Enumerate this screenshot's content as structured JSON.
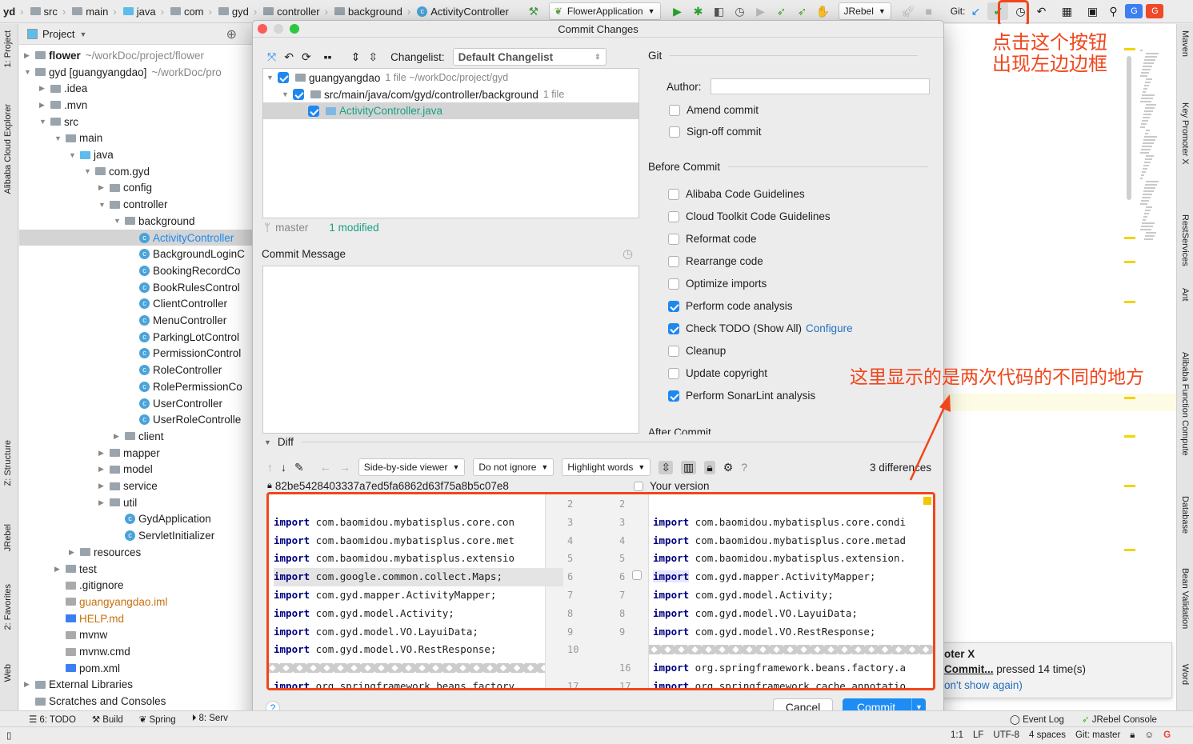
{
  "navbar": {
    "breadcrumbs": [
      "yd",
      "src",
      "main",
      "java",
      "com",
      "gyd",
      "controller",
      "background",
      "ActivityController"
    ],
    "run_config": "FlowerApplication",
    "jrebel": "JRebel",
    "git_label": "Git:"
  },
  "left_strip": [
    "1: Project",
    "Alibaba Cloud Explorer",
    "Z: Structure",
    "JRebel",
    "2: Favorites",
    "Web"
  ],
  "right_strip": [
    "Maven",
    "Key Promoter X",
    "RestServices",
    "Ant",
    "Alibaba Function Compute",
    "Database",
    "Bean Validation",
    "Word"
  ],
  "project": {
    "title": "Project",
    "tree": [
      {
        "label": "flower",
        "hint": "~/workDoc/project/flower",
        "level": 0,
        "arrow": "right",
        "icon": "module",
        "bold": true
      },
      {
        "label": "gyd [guangyangdao]",
        "hint": "~/workDoc/pro",
        "level": 0,
        "arrow": "down",
        "icon": "module",
        "bold": false
      },
      {
        "label": ".idea",
        "level": 1,
        "arrow": "right",
        "icon": "folder"
      },
      {
        "label": ".mvn",
        "level": 1,
        "arrow": "right",
        "icon": "folder"
      },
      {
        "label": "src",
        "level": 1,
        "arrow": "down",
        "icon": "folder"
      },
      {
        "label": "main",
        "level": 2,
        "arrow": "down",
        "icon": "folder"
      },
      {
        "label": "java",
        "level": 3,
        "arrow": "down",
        "icon": "folder-blue"
      },
      {
        "label": "com.gyd",
        "level": 4,
        "arrow": "down",
        "icon": "package"
      },
      {
        "label": "config",
        "level": 5,
        "arrow": "right",
        "icon": "package"
      },
      {
        "label": "controller",
        "level": 5,
        "arrow": "down",
        "icon": "package"
      },
      {
        "label": "background",
        "level": 6,
        "arrow": "down",
        "icon": "package"
      },
      {
        "label": "ActivityController",
        "level": 7,
        "icon": "class",
        "selected": true
      },
      {
        "label": "BackgroundLoginC",
        "level": 7,
        "icon": "class"
      },
      {
        "label": "BookingRecordCo",
        "level": 7,
        "icon": "class"
      },
      {
        "label": "BookRulesControl",
        "level": 7,
        "icon": "class"
      },
      {
        "label": "ClientController",
        "level": 7,
        "icon": "class"
      },
      {
        "label": "MenuController",
        "level": 7,
        "icon": "class"
      },
      {
        "label": "ParkingLotControl",
        "level": 7,
        "icon": "class"
      },
      {
        "label": "PermissionControl",
        "level": 7,
        "icon": "class"
      },
      {
        "label": "RoleController",
        "level": 7,
        "icon": "class"
      },
      {
        "label": "RolePermissionCo",
        "level": 7,
        "icon": "class"
      },
      {
        "label": "UserController",
        "level": 7,
        "icon": "class"
      },
      {
        "label": "UserRoleControlle",
        "level": 7,
        "icon": "class"
      },
      {
        "label": "client",
        "level": 6,
        "arrow": "right",
        "icon": "package"
      },
      {
        "label": "mapper",
        "level": 5,
        "arrow": "right",
        "icon": "package"
      },
      {
        "label": "model",
        "level": 5,
        "arrow": "right",
        "icon": "package"
      },
      {
        "label": "service",
        "level": 5,
        "arrow": "right",
        "icon": "package"
      },
      {
        "label": "util",
        "level": 5,
        "arrow": "right",
        "icon": "package"
      },
      {
        "label": "GydApplication",
        "level": 6,
        "icon": "spring-class"
      },
      {
        "label": "ServletInitializer",
        "level": 6,
        "icon": "class"
      },
      {
        "label": "resources",
        "level": 3,
        "arrow": "right",
        "icon": "folder"
      },
      {
        "label": "test",
        "level": 2,
        "arrow": "right",
        "icon": "folder"
      },
      {
        "label": ".gitignore",
        "level": 2,
        "icon": "file"
      },
      {
        "label": "guangyangdao.iml",
        "level": 2,
        "icon": "file",
        "color": "#c7700f"
      },
      {
        "label": "HELP.md",
        "level": 2,
        "icon": "md",
        "color": "#c7700f"
      },
      {
        "label": "mvnw",
        "level": 2,
        "icon": "file"
      },
      {
        "label": "mvnw.cmd",
        "level": 2,
        "icon": "file"
      },
      {
        "label": "pom.xml",
        "level": 2,
        "icon": "maven"
      },
      {
        "label": "External Libraries",
        "level": 0,
        "arrow": "right",
        "icon": "library"
      },
      {
        "label": "Scratches and Consoles",
        "level": 0,
        "icon": "scratch"
      }
    ]
  },
  "dialog": {
    "title": "Commit Changes",
    "changelist_label": "Changelist:",
    "changelist_value": "Default Changelist",
    "changes": [
      {
        "label": "guangyangdao",
        "hint": "1 file  ~/workDoc/project/gyd"
      },
      {
        "label": "src/main/java/com/gyd/controller/background",
        "hint": "1 file"
      },
      {
        "label": "ActivityController.java",
        "hint": ""
      }
    ],
    "branch": "master",
    "modified": "1 modified",
    "commit_message_label": "Commit Message",
    "commit_message": "",
    "git_section": "Git",
    "author_label": "Author:",
    "author_value": "",
    "git_options": [
      {
        "label": "Amend commit",
        "checked": false
      },
      {
        "label": "Sign-off commit",
        "checked": false
      }
    ],
    "before_commit_label": "Before Commit",
    "before_commit": [
      {
        "label": "Alibaba Code Guidelines",
        "checked": false
      },
      {
        "label": "Cloud Toolkit Code Guidelines",
        "checked": false
      },
      {
        "label": "Reformat code",
        "checked": false
      },
      {
        "label": "Rearrange code",
        "checked": false
      },
      {
        "label": "Optimize imports",
        "checked": false
      },
      {
        "label": "Perform code analysis",
        "checked": true
      },
      {
        "label": "Check TODO (Show All)",
        "checked": true,
        "link": "Configure"
      },
      {
        "label": "Cleanup",
        "checked": false
      },
      {
        "label": "Update copyright",
        "checked": false
      },
      {
        "label": "Perform SonarLint analysis",
        "checked": true
      }
    ],
    "after_commit_label": "After Commit",
    "diff_label": "Diff",
    "viewer": "Side-by-side viewer",
    "ignore": "Do not ignore",
    "highlight": "Highlight words",
    "differences": "3 differences",
    "left_title": "82be5428403337a7ed5fa6862d63f75a8b5c07e8",
    "right_title": "Your version",
    "diff_rows": [
      {
        "l": {
          "n": "2",
          "kw": "",
          "c": ""
        },
        "r": {
          "n": "2",
          "kw": "",
          "c": ""
        }
      },
      {
        "l": {
          "n": "3",
          "kw": "import",
          "c": " com.baomidou.mybatisplus.core.con"
        },
        "r": {
          "n": "3",
          "kw": "import",
          "c": " com.baomidou.mybatisplus.core.condi"
        }
      },
      {
        "l": {
          "n": "4",
          "kw": "import",
          "c": " com.baomidou.mybatisplus.core.met"
        },
        "r": {
          "n": "4",
          "kw": "import",
          "c": " com.baomidou.mybatisplus.core.metad"
        }
      },
      {
        "l": {
          "n": "5",
          "kw": "import",
          "c": " com.baomidou.mybatisplus.extensio"
        },
        "r": {
          "n": "5",
          "kw": "import",
          "c": " com.baomidou.mybatisplus.extension."
        }
      },
      {
        "l": {
          "n": "6",
          "kw": "import",
          "c": " com.google.common.collect.Maps;",
          "deleted": true
        },
        "r": {
          "n": "6",
          "kw": "import",
          "c": " com.gyd.mapper.ActivityMapper;"
        }
      },
      {
        "l": {
          "n": "7",
          "kw": "import",
          "c": " com.gyd.mapper.ActivityMapper;"
        },
        "r": {
          "n": "7",
          "kw": "import",
          "c": " com.gyd.model.Activity;"
        }
      },
      {
        "l": {
          "n": "8",
          "kw": "import",
          "c": " com.gyd.model.Activity;"
        },
        "r": {
          "n": "8",
          "kw": "import",
          "c": " com.gyd.model.VO.LayuiData;"
        }
      },
      {
        "l": {
          "n": "9",
          "kw": "import",
          "c": " com.gyd.model.VO.LayuiData;"
        },
        "r": {
          "n": "9",
          "kw": "import",
          "c": " com.gyd.model.VO.RestResponse;"
        }
      },
      {
        "l": {
          "n": "10",
          "kw": "import",
          "c": " com.gyd.model.VO.RestResponse;"
        },
        "r": {
          "fold": true
        }
      },
      {
        "l": {
          "fold": true
        },
        "r": {
          "n": "16",
          "kw": "import",
          "c": " org.springframework.beans.factory.a"
        }
      },
      {
        "l": {
          "n": "17",
          "kw": "import",
          "c": " org.springframework.beans.factory"
        },
        "r": {
          "n": "17",
          "kw": "import",
          "c": " org.springframework.cache.annotatio"
        }
      }
    ],
    "cancel": "Cancel",
    "commit": "Commit",
    "help": "?"
  },
  "notification": {
    "title": "oter X",
    "action": "Commit...",
    "text": " pressed 14 time(s)",
    "link": "on't show again)"
  },
  "annotations": {
    "top": [
      "点击这个按钮",
      "出现左边边框"
    ],
    "diff": "这里显示的是两次代码的不同的地方",
    "color": "#f0461c"
  },
  "bottom_tools": [
    "6: TODO",
    "Build",
    "Spring",
    "8: Serv"
  ],
  "bottom_right_tools": [
    "Event Log",
    "JRebel Console"
  ],
  "status": {
    "position": "1:1",
    "line_sep": "LF",
    "encoding": "UTF-8",
    "indent": "4 spaces",
    "branch": "Git: master"
  },
  "colors": {
    "accent": "#1e88f0",
    "selected_file": "#16a085",
    "keyword": "#000080",
    "highlight_border": "#f0461c"
  }
}
